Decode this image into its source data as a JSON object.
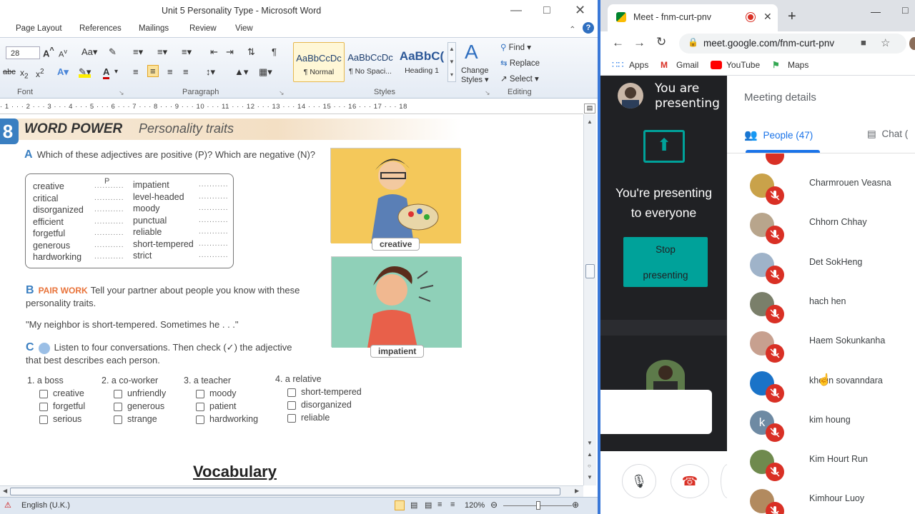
{
  "word": {
    "title": "Unit 5 Personality Type  -  Microsoft Word",
    "tabs": [
      "Page Layout",
      "References",
      "Mailings",
      "Review",
      "View"
    ],
    "font_size": "28",
    "groups": [
      "Font",
      "Paragraph",
      "Styles",
      "Editing"
    ],
    "styles": [
      {
        "preview": "AaBbCcDc",
        "name": "¶ Normal"
      },
      {
        "preview": "AaBbCcDc",
        "name": "¶ No Spaci..."
      },
      {
        "preview": "AaBbC(",
        "name": "Heading 1"
      }
    ],
    "change_styles": [
      "Change",
      "Styles"
    ],
    "editing": {
      "find": "Find",
      "replace": "Replace",
      "select": "Select"
    },
    "ruler": "· 1 · · · 2 · · · 3 · · · 4 · · · 5 · · · 6 · · · 7 · · · 8 · · · 9 · · · 10 · · · 11 · · · 12 · · · 13 · · · 14 · · · 15 · · · 16 · · · 17 · · · 18",
    "status": {
      "language": "English (U.K.)",
      "zoom": "120%"
    },
    "doc": {
      "section_number": "8",
      "banner_title": "WORD POWER",
      "banner_subtitle": "Personality traits",
      "a_letter": "A",
      "a_text": "Which of these adjectives are positive (P)? Which are negative (N)?",
      "left_adjectives": [
        "creative",
        "critical",
        "disorganized",
        "efficient",
        "forgetful",
        "generous",
        "hardworking"
      ],
      "right_adjectives": [
        "impatient",
        "level-headed",
        "moody",
        "punctual",
        "reliable",
        "short-tempered",
        "strict"
      ],
      "sample_answer": "P",
      "b_letter": "B",
      "b_label": "PAIR WORK",
      "b_text": "Tell your partner about people you know with these",
      "b_text2": "personality traits.",
      "quote": "\"My neighbor is short-tempered. Sometimes he . . .\"",
      "c_letter": "C",
      "c_text": "Listen to four conversations. Then check (✓) the adjective",
      "c_text2": "that best describes each person.",
      "pic1_label": "creative",
      "pic2_label": "impatient",
      "groups": [
        {
          "label": "1.  a boss",
          "options": [
            "creative",
            "forgetful",
            "serious"
          ]
        },
        {
          "label": "2.  a co-worker",
          "options": [
            "unfriendly",
            "generous",
            "strange"
          ]
        },
        {
          "label": "3.  a teacher",
          "options": [
            "moody",
            "patient",
            "hardworking"
          ]
        },
        {
          "label": "4.  a relative",
          "options": [
            "short-tempered",
            "disorganized",
            "reliable"
          ]
        }
      ],
      "vocabulary": "Vocabulary"
    }
  },
  "chrome": {
    "tab_title": "Meet - fnm-curt-pnv",
    "url": "meet.google.com/fnm-curt-pnv",
    "bookmarks": [
      "Apps",
      "Gmail",
      "YouTube",
      "Maps"
    ]
  },
  "meet": {
    "you_are_presenting": [
      "You are",
      "presenting"
    ],
    "presenting_everyone": [
      "You're presenting",
      "to everyone"
    ],
    "stop_button": [
      "Stop",
      "presenting"
    ],
    "details_title": "Meeting details",
    "people_tab": "People (47)",
    "chat_tab": "Chat (",
    "participants": [
      {
        "name": "Charmrouen Veasna",
        "avatar_color": "#c9a24a"
      },
      {
        "name": "Chhorn Chhay",
        "avatar_color": "#b8a58c"
      },
      {
        "name": "Det SokHeng",
        "avatar_color": "#9fb3c9"
      },
      {
        "name": "hach hen",
        "avatar_color": "#7a7f6a"
      },
      {
        "name": "Haem Sokunkanha",
        "avatar_color": "#c7a08f"
      },
      {
        "name": "khoun sovanndara",
        "avatar_color": "#1a73c8"
      },
      {
        "name": "kim houng",
        "avatar_color": "#6e8aa3",
        "initial": "k"
      },
      {
        "name": "Kim Hourt Run",
        "avatar_color": "#6f8a4e"
      },
      {
        "name": "Kimhour Luoy",
        "avatar_color": "#b28a5f"
      }
    ],
    "colors": {
      "accent": "#1a73e8",
      "teal": "#00a29a",
      "mute": "#d93025",
      "dark": "#202124"
    }
  }
}
